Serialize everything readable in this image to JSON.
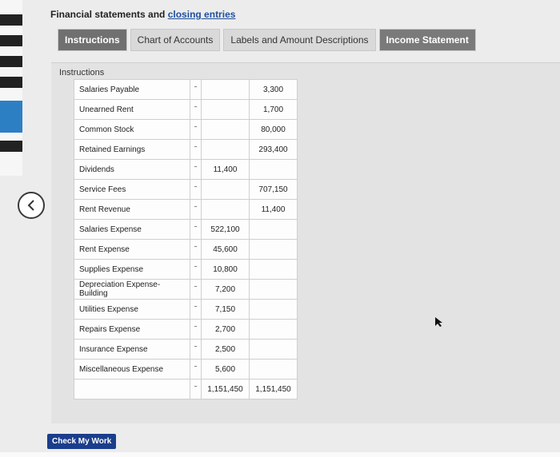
{
  "title": {
    "prefix": "Financial statements and ",
    "link": "closing entries"
  },
  "tabs": [
    "Instructions",
    "Chart of Accounts",
    "Labels and Amount Descriptions",
    "Income Statement"
  ],
  "panel_label": "Instructions",
  "rows": [
    {
      "account": "Salaries Payable",
      "debit": "",
      "credit": "3,300"
    },
    {
      "account": "Unearned Rent",
      "debit": "",
      "credit": "1,700"
    },
    {
      "account": "Common Stock",
      "debit": "",
      "credit": "80,000"
    },
    {
      "account": "Retained Earnings",
      "debit": "",
      "credit": "293,400"
    },
    {
      "account": "Dividends",
      "debit": "11,400",
      "credit": ""
    },
    {
      "account": "Service Fees",
      "debit": "",
      "credit": "707,150"
    },
    {
      "account": "Rent Revenue",
      "debit": "",
      "credit": "11,400"
    },
    {
      "account": "Salaries Expense",
      "debit": "522,100",
      "credit": ""
    },
    {
      "account": "Rent Expense",
      "debit": "45,600",
      "credit": ""
    },
    {
      "account": "Supplies Expense",
      "debit": "10,800",
      "credit": ""
    },
    {
      "account": "Depreciation Expense-Building",
      "debit": "7,200",
      "credit": ""
    },
    {
      "account": "Utilities Expense",
      "debit": "7,150",
      "credit": ""
    },
    {
      "account": "Repairs Expense",
      "debit": "2,700",
      "credit": ""
    },
    {
      "account": "Insurance Expense",
      "debit": "2,500",
      "credit": ""
    },
    {
      "account": "Miscellaneous Expense",
      "debit": "5,600",
      "credit": ""
    }
  ],
  "totals": {
    "debit": "1,151,450",
    "credit": "1,151,450"
  },
  "check_button": "Check My Work"
}
